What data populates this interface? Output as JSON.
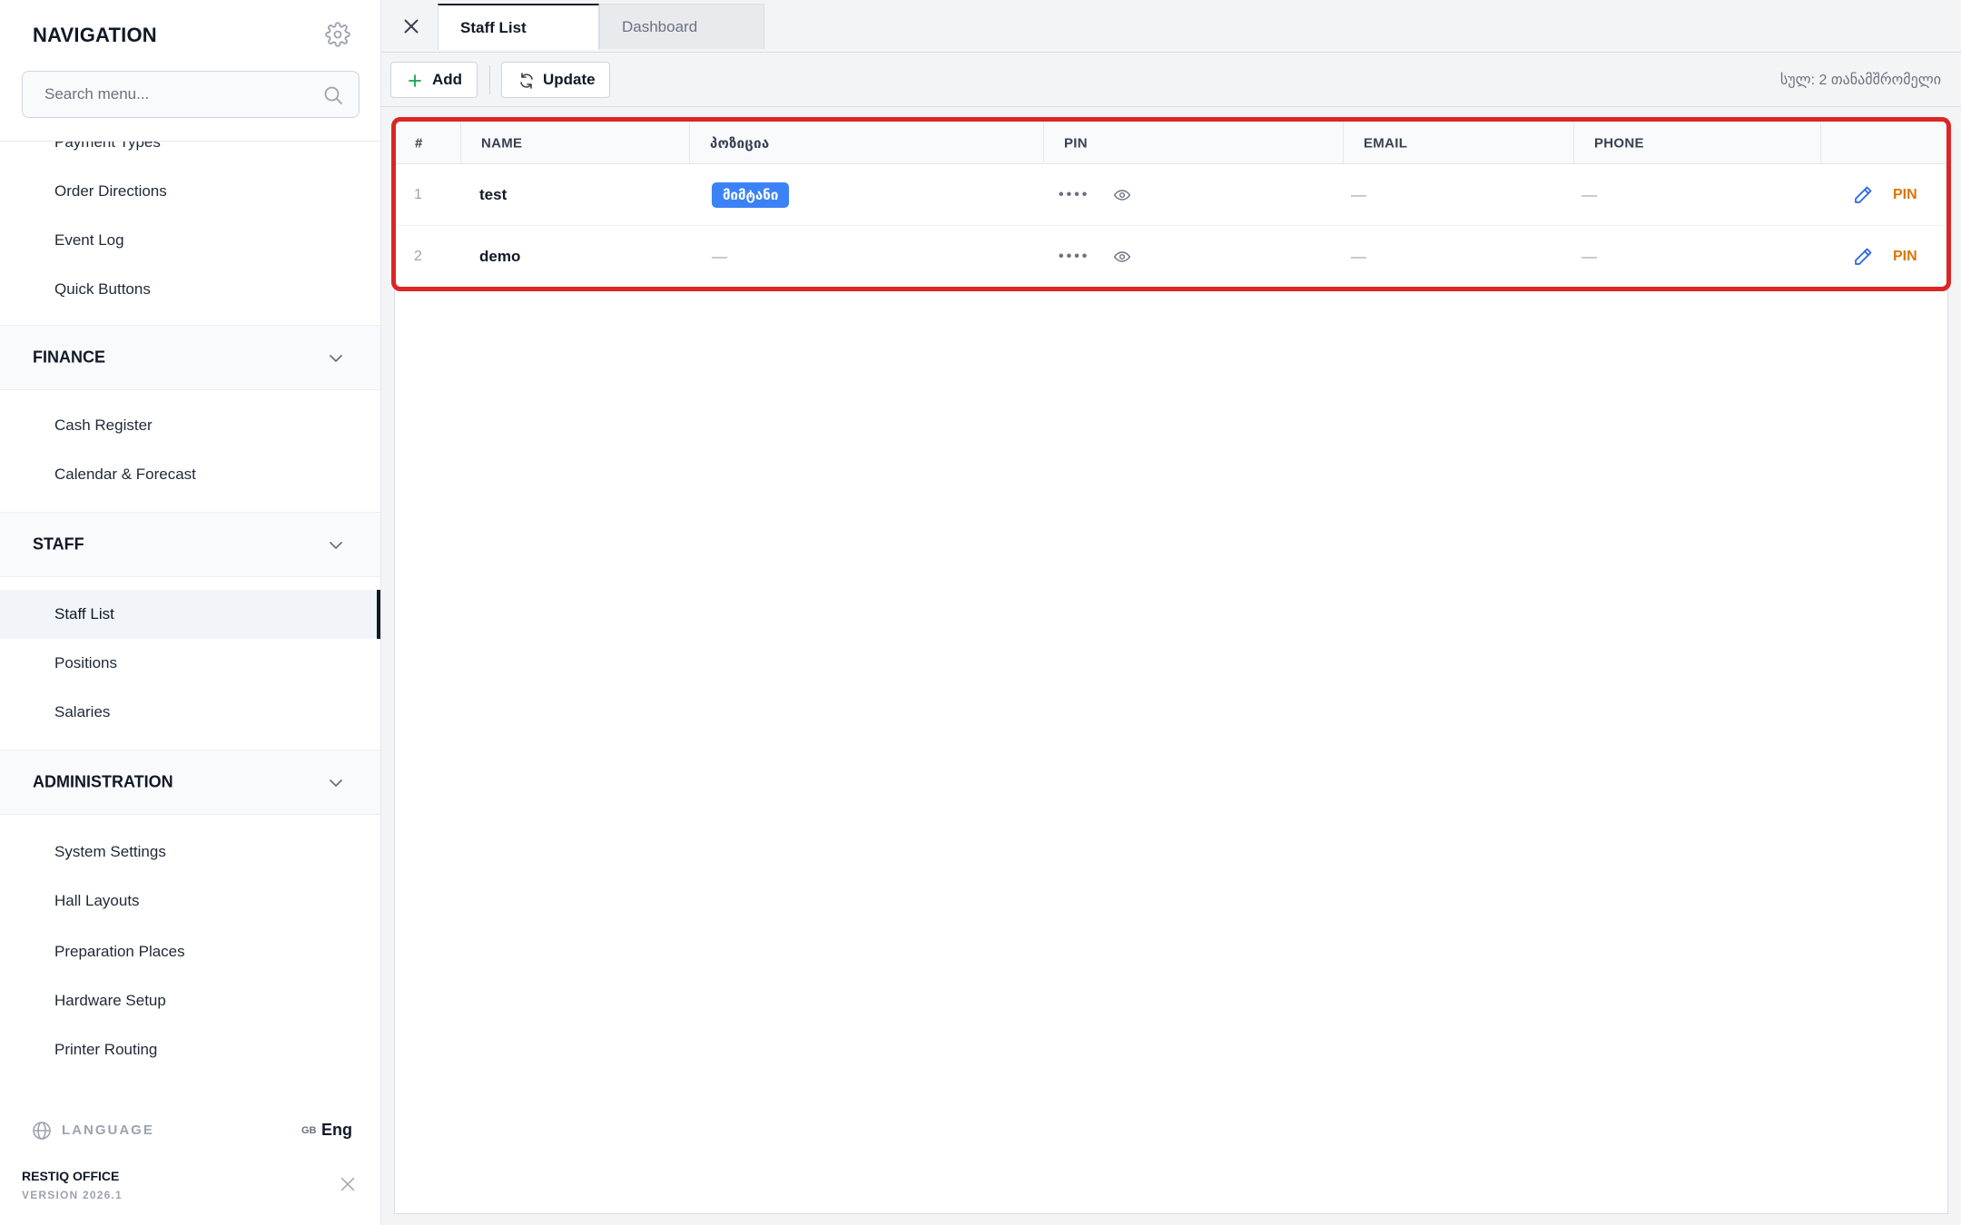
{
  "sidebar": {
    "title": "NAVIGATION",
    "search_placeholder": "Search menu...",
    "items_top": [
      "Payment Types",
      "Order Directions",
      "Event Log",
      "Quick Buttons"
    ],
    "groups": {
      "finance": {
        "label": "FINANCE",
        "items": [
          "Cash Register",
          "Calendar & Forecast"
        ]
      },
      "staff": {
        "label": "STAFF",
        "items": [
          "Staff List",
          "Positions",
          "Salaries"
        ]
      },
      "administration": {
        "label": "ADMINISTRATION",
        "items": [
          "System Settings",
          "Hall Layouts",
          "Preparation Places",
          "Hardware Setup",
          "Printer Routing"
        ]
      }
    },
    "language_label": "LANGUAGE",
    "language_flag": "GB",
    "language_value": "Eng",
    "brand": "RESTIQ OFFICE",
    "version": "VERSION 2026.1"
  },
  "tabs": [
    "Staff List",
    "Dashboard"
  ],
  "toolbar": {
    "add_label": "Add",
    "update_label": "Update",
    "total": "სულ: 2 თანამშრომელი"
  },
  "table": {
    "columns": [
      "#",
      "NAME",
      "პოზიცია",
      "PIN",
      "EMAIL",
      "PHONE"
    ],
    "rows": [
      {
        "num": "1",
        "name": "test",
        "position": "მიმტანი",
        "pin": "••••",
        "email": "—",
        "phone": "—",
        "action": "PIN"
      },
      {
        "num": "2",
        "name": "demo",
        "position": "—",
        "pin": "••••",
        "email": "—",
        "phone": "—",
        "action": "PIN"
      }
    ]
  },
  "colors": {
    "accent": "#3b82f6",
    "highlight_border": "#dc2626",
    "pin_action": "#d97706",
    "active_indicator": "#111827"
  },
  "icons": [
    "gear-icon",
    "search-icon",
    "chevron-down-icon",
    "globe-icon",
    "close-icon",
    "plus-icon",
    "refresh-icon",
    "eye-icon",
    "pencil-icon"
  ]
}
